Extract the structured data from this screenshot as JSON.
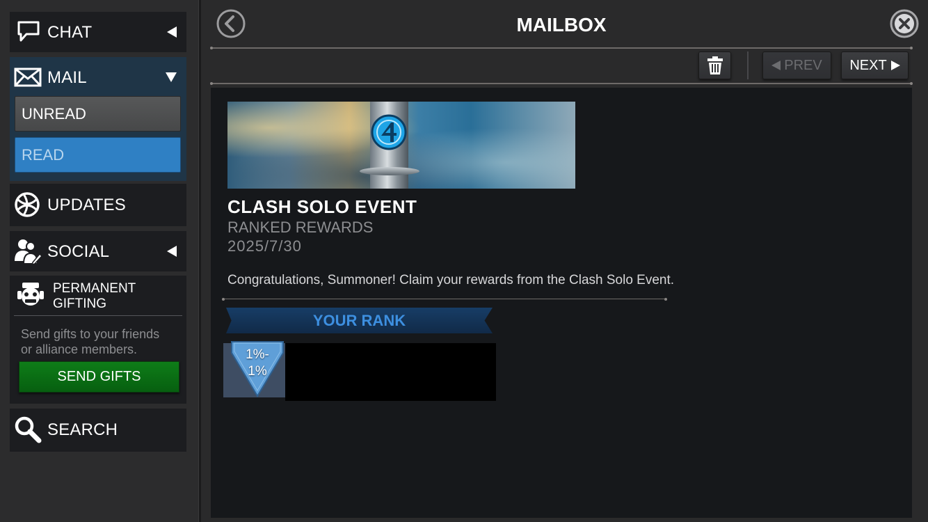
{
  "sidebar": {
    "chat": {
      "label": "CHAT",
      "icon": "chat-bubble-icon"
    },
    "mail": {
      "label": "MAIL",
      "icon": "envelope-icon",
      "unread_label": "UNREAD",
      "read_label": "READ"
    },
    "updates": {
      "label": "UPDATES",
      "icon": "globe-icon"
    },
    "social": {
      "label": "SOCIAL",
      "icon": "people-icon"
    },
    "gifting": {
      "title_line1": "PERMANENT",
      "title_line2": "GIFTING",
      "icon": "robot-mascot-icon",
      "description_line1": "Send gifts to your friends",
      "description_line2": "or alliance members.",
      "button_label": "SEND GIFTS"
    },
    "search": {
      "label": "SEARCH",
      "icon": "magnifier-icon"
    }
  },
  "header": {
    "title": "MAILBOX",
    "back_icon": "chevron-left-circle-icon",
    "close_icon": "close-circle-icon"
  },
  "toolbar": {
    "delete_icon": "trash-icon",
    "prev_label": "PREV",
    "next_label": "NEXT",
    "prev_enabled": false
  },
  "message": {
    "banner_icon": "fantastic-four-emblem-icon",
    "title": "CLASH SOLO EVENT",
    "subtitle": "RANKED REWARDS",
    "date": "2025/7/30",
    "body": "Congratulations, Summoner! Claim your rewards from the Clash Solo Event.",
    "rank_heading": "YOUR RANK",
    "rank_value_line1": "1%-",
    "rank_value_line2": "1%"
  },
  "colors": {
    "read_selected": "#2f80c4",
    "send_gifts_green": "#0a6b12",
    "rank_text_blue": "#3d8fe0"
  }
}
